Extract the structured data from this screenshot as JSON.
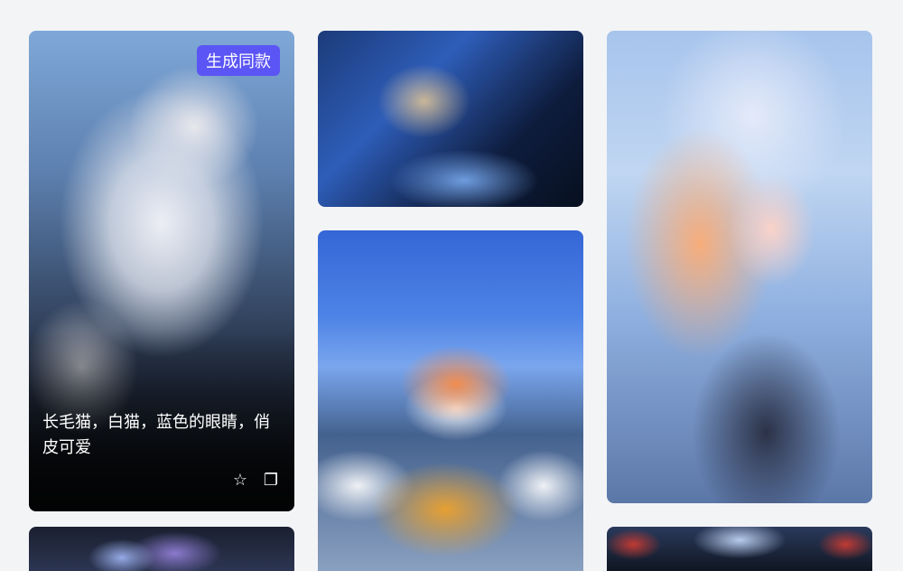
{
  "feed": {
    "cards": [
      {
        "subject": "white-cat",
        "generate_label": "生成同款",
        "caption": "长毛猫，白猫，蓝色的眼睛，俏皮可爱",
        "actions": {
          "favorite_icon": "☆",
          "copy_icon": "❐"
        }
      },
      {
        "subject": "cyborg-woman"
      },
      {
        "subject": "corgi-backpack"
      },
      {
        "subject": "white-haired-girl"
      },
      {
        "subject": "flower-girl"
      },
      {
        "subject": "sci-fi-city"
      }
    ]
  },
  "colors": {
    "background": "#f3f4f6",
    "accent": "#5b55f5"
  }
}
